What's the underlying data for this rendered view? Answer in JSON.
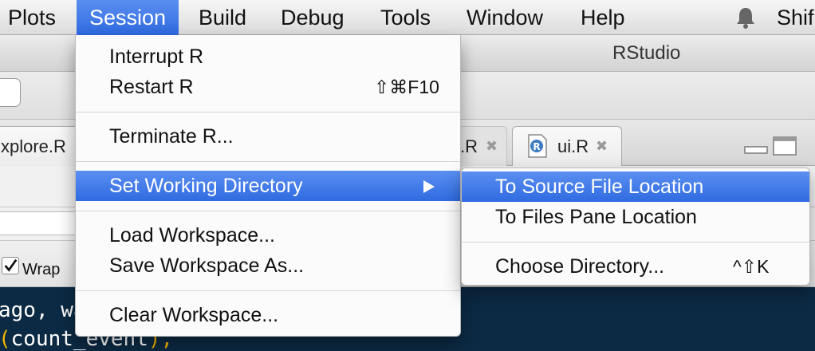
{
  "menubar": {
    "items": [
      "Plots",
      "Session",
      "Build",
      "Debug",
      "Tools",
      "Window",
      "Help"
    ],
    "active": "Session",
    "user": "Shif"
  },
  "window": {
    "title": "RStudio"
  },
  "tabs": [
    {
      "label": "xplore.R"
    },
    {
      "label": ".R",
      "close": "✖"
    },
    {
      "label": "ui.R",
      "close": "✖"
    }
  ],
  "editor": {
    "wrap_label": "Wrap",
    "wrap_checked": true
  },
  "code": {
    "line1": "ago, wa",
    "line2_paren": "(",
    "line2_text": "count_event",
    "line2_end": "),"
  },
  "session_menu": {
    "items": [
      {
        "label": "Interrupt R",
        "shortcut": ""
      },
      {
        "label": "Restart R",
        "shortcut": "⇧⌘F10"
      },
      {
        "label": "Terminate R...",
        "shortcut": ""
      },
      {
        "label": "Set Working Directory",
        "shortcut": "",
        "submenu": true,
        "highlighted": true
      },
      {
        "label": "Load Workspace...",
        "shortcut": ""
      },
      {
        "label": "Save Workspace As...",
        "shortcut": ""
      },
      {
        "label": "Clear Workspace...",
        "shortcut": ""
      }
    ]
  },
  "submenu": {
    "items": [
      {
        "label": "To Source File Location",
        "shortcut": "",
        "highlighted": true
      },
      {
        "label": "To Files Pane Location",
        "shortcut": ""
      },
      {
        "label": "Choose Directory...",
        "shortcut": "^⇧K"
      }
    ]
  },
  "colors": {
    "highlight": "#2f6be1",
    "console_bg": "#0c2a44",
    "paren": "#f0b400"
  }
}
